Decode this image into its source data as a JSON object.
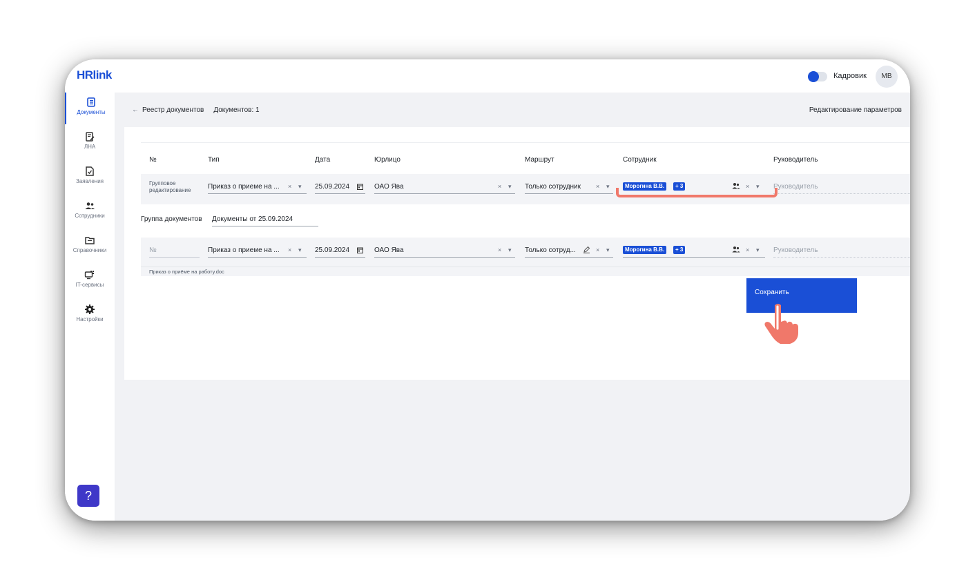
{
  "app": {
    "logo": "HRlink",
    "role_label": "Кадровик",
    "avatar_initials": "МВ",
    "accent": "#1a4fd6"
  },
  "sidebar": {
    "items": [
      {
        "label": "Документы",
        "icon": "documents-icon",
        "active": true
      },
      {
        "label": "ЛНА",
        "icon": "lna-icon"
      },
      {
        "label": "Заявления",
        "icon": "applications-icon"
      },
      {
        "label": "Сотрудники",
        "icon": "employees-icon"
      },
      {
        "label": "Справочники",
        "icon": "folder-icon"
      },
      {
        "label": "IT-сервисы",
        "icon": "it-services-icon"
      },
      {
        "label": "Настройки",
        "icon": "gear-icon"
      }
    ],
    "help_label": "?"
  },
  "breadcrumb": {
    "back_label": "Реестр документов",
    "count_label": "Документов: 1"
  },
  "header_action": "Редактирование параметров",
  "columns": [
    "№",
    "Тип",
    "Дата",
    "Юрлицо",
    "Маршрут",
    "Сотрудник",
    "Руководитель"
  ],
  "group_row": {
    "label_line1": "Групповое",
    "label_line2": "редактирование",
    "type": "Приказ о приеме на ...",
    "date": "25.09.2024",
    "entity": "ОАО Ява",
    "route": "Только сотрудник",
    "employee_chip": "Морогина В.В.",
    "employee_extra": "+ 3",
    "manager_placeholder": "Руководитель"
  },
  "doc_group": {
    "label": "Группа документов",
    "value": "Документы от 25.09.2024"
  },
  "doc_row": {
    "number_placeholder": "№",
    "type": "Приказ о приеме на ...",
    "date": "25.09.2024",
    "entity": "ОАО Ява",
    "route": "Только сотруд...",
    "employee_chip": "Морогина В.В.",
    "employee_extra": "+ 3",
    "manager_placeholder": "Руководитель",
    "filename": "Приказ о приёме на работу.doc"
  },
  "save_button": "Сохранить",
  "glyphs": {
    "clear": "×",
    "caret": "▾",
    "back_arrow": "←"
  }
}
